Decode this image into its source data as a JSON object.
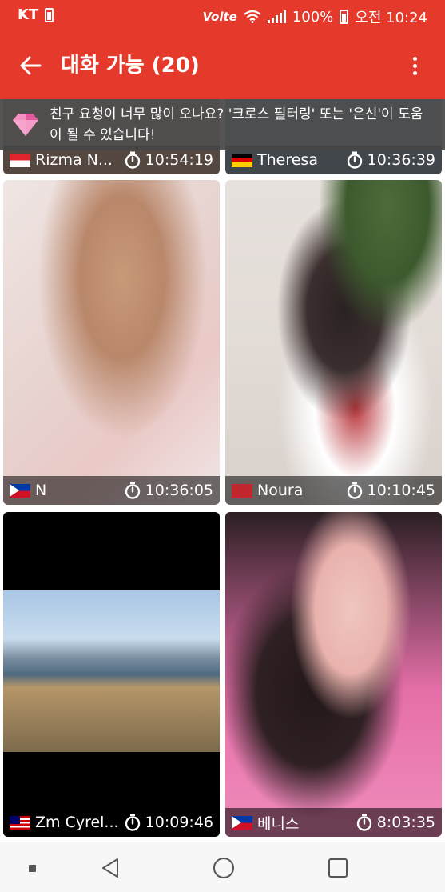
{
  "status_bar": {
    "carrier": "KT",
    "network": "Volte",
    "battery": "100%",
    "time": "오전 10:24"
  },
  "app_bar": {
    "title": "대화 가능 (20)",
    "back_icon": "arrow-left-icon",
    "menu_icon": "more-vert-icon"
  },
  "banner": {
    "icon": "gem-icon",
    "text": "친구 요청이 너무 많이 오나요? '크로스 필터링' 또는 '은신'이 도움이 될 수 있습니다!"
  },
  "cards": [
    {
      "name": "Rizma N...",
      "time": "10:54:19",
      "flag": "Indonesia"
    },
    {
      "name": "Theresa",
      "time": "10:36:39",
      "flag": "Germany"
    },
    {
      "name": "N",
      "time": "10:36:05",
      "flag": "Philippines"
    },
    {
      "name": "Noura",
      "time": "10:10:45",
      "flag": "Morocco"
    },
    {
      "name": "Zm Cyrel...",
      "time": "10:09:46",
      "flag": "Malaysia"
    },
    {
      "name": "베니스",
      "time": "8:03:35",
      "flag": "Philippines"
    }
  ],
  "nav_bar": {
    "recent_icon": "square-small-icon",
    "back_icon": "triangle-back-icon",
    "home_icon": "circle-home-icon",
    "overview_icon": "square-overview-icon"
  },
  "colors": {
    "primary": "#e53a2b",
    "banner_bg": "#464646",
    "card_bar": "#000000"
  }
}
